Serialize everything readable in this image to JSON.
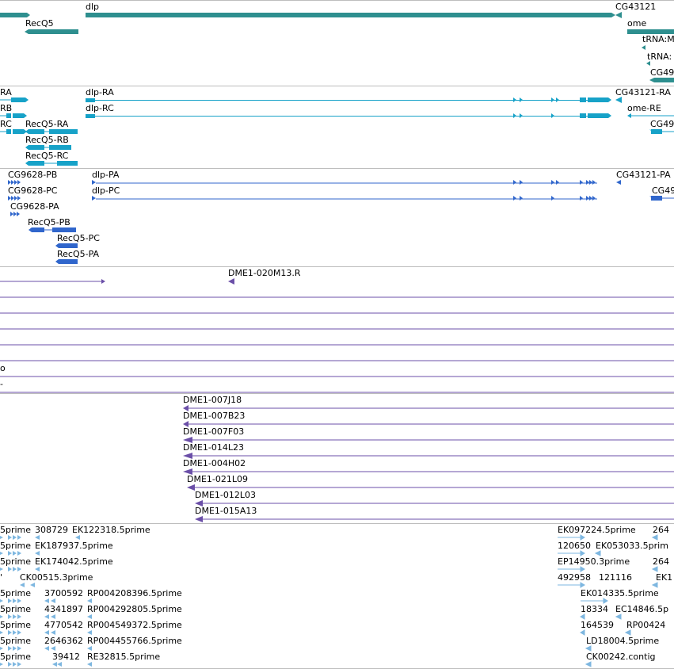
{
  "colors": {
    "gene": "#2e8f8f",
    "transcript_cyan": "#17a2c8",
    "transcript_blue": "#3066cc",
    "clone": "#6b4fa8",
    "est": "#7eb7e0",
    "divider": "#bdbdbd"
  },
  "tracks": {
    "genes": {
      "labels": [
        "RecQ5",
        "dlp",
        "CG43121",
        "ome",
        "tRNA:M",
        "tRNA:",
        "CG49"
      ]
    },
    "transcripts_a": {
      "labels": [
        "RA",
        "RB",
        "RC",
        "RecQ5-RA",
        "RecQ5-RB",
        "RecQ5-RC",
        "dlp-RA",
        "dlp-RC",
        "CG43121-RA",
        "ome-RE",
        "CG49"
      ]
    },
    "transcripts_b": {
      "labels": [
        "CG9628-PB",
        "CG9628-PC",
        "CG9628-PA",
        "RecQ5-PB",
        "RecQ5-PC",
        "RecQ5-PA",
        "dlp-PA",
        "dlp-PC",
        "CG43121-PA",
        "CG49"
      ]
    },
    "clones": {
      "labels": [
        "DME1-020M13.R",
        "o",
        "-",
        "DME1-007J18",
        "DME1-007B23",
        "DME1-007F03",
        "DME1-014L23",
        "DME1-004H02",
        "DME1-021L09",
        "DME1-012L03",
        "DME1-015A13"
      ]
    },
    "ests": {
      "labels": [
        "5prime",
        "308729",
        "EK122318.5prime",
        "5prime",
        "EK187937.5prime",
        "5prime",
        "EK174042.5prime",
        "'",
        "CK00515.3prime",
        "5prime",
        "3700592",
        "RP004208396.5prime",
        "5prime",
        "4341897",
        "RP004292805.5prime",
        "5prime",
        "4770542",
        "RP004549372.5prime",
        "5prime",
        "2646362",
        "RP004455766.5prime",
        "5prime",
        "39412",
        "RE32815.5prime",
        "EK097224.5prime",
        "264",
        "120650",
        "EK053033.5prim",
        "EP14950.3prime",
        "264",
        "492958",
        "121116",
        "EK1",
        "EK014335.5prime",
        "18334",
        "EC14846.5p",
        "164539",
        "RP00424",
        "LD18004.5prime",
        "CK00242.contig"
      ]
    }
  }
}
